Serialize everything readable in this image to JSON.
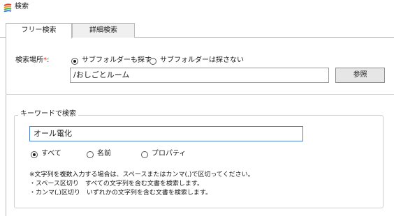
{
  "window": {
    "title": "検索"
  },
  "tabs": [
    {
      "label": "フリー検索",
      "active": true
    },
    {
      "label": "詳細検索",
      "active": false
    }
  ],
  "location": {
    "label": "検索場所",
    "required_mark": "*",
    "colon": ":",
    "options": [
      {
        "label": "サブフォルダーも探す",
        "checked": true
      },
      {
        "label": "サブフォルダーは探さない",
        "checked": false
      }
    ],
    "path_value": "/おしごとルーム",
    "browse_label": "参照"
  },
  "keyword": {
    "legend": "キーワードで検索",
    "value": "オール電化",
    "options": [
      {
        "label": "すべて",
        "checked": true
      },
      {
        "label": "名前",
        "checked": false
      },
      {
        "label": "プロパティ",
        "checked": false
      }
    ],
    "notes": [
      "※文字列を複数入力する場合は、スペースまたはカンマ(,)で区切ってください。",
      "・スペース区切り　すべての文字列を含む文書を検索します。",
      "・カンマ(,)区切り　いずれかの文字列を含む文書を検索します。"
    ]
  },
  "colors": {
    "required": "#e0301e",
    "focus_border": "#4a7fd4",
    "icon_red": "#e8402c",
    "icon_orange": "#f59a1b",
    "icon_green": "#4caf50",
    "icon_blue": "#3d7fd9"
  },
  "icons": {
    "app": "multicolor-stripes-icon"
  }
}
